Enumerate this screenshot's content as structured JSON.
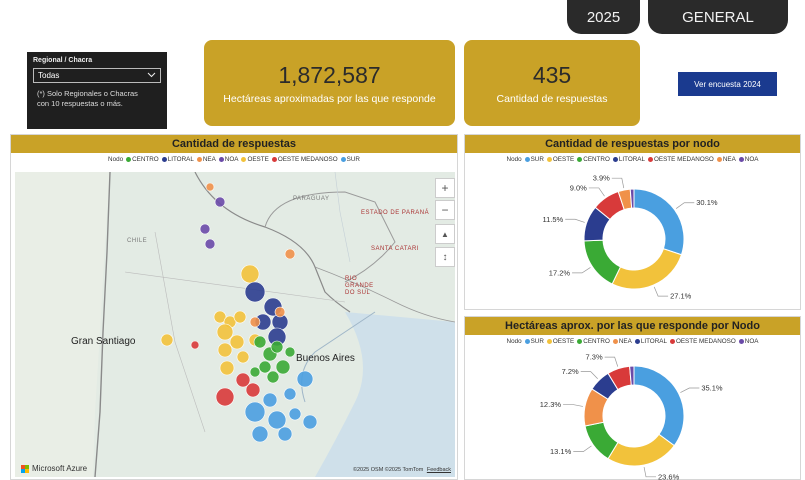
{
  "header": {
    "year_label": "2025",
    "general_label": "GENERAL"
  },
  "slicer": {
    "title": "Regional / Chacra",
    "selected": "Todas",
    "note_line1": "(*) Solo Regionales o Chacras",
    "note_line2": "con 10 respuestas o más."
  },
  "kpis": {
    "hectares_value": "1,872,587",
    "hectares_label": "Hectáreas aproximadas por las que responde",
    "responses_value": "435",
    "responses_label": "Cantidad de respuestas"
  },
  "button_2024": "Ver encuesta 2024",
  "map_panel": {
    "title": "Cantidad de respuestas",
    "legend_title": "Nodo",
    "legend": [
      {
        "name": "CENTRO",
        "color": "#3aaa35"
      },
      {
        "name": "LITORAL",
        "color": "#2b3d8f"
      },
      {
        "name": "NEA",
        "color": "#f0914a"
      },
      {
        "name": "NOA",
        "color": "#6a4aa8"
      },
      {
        "name": "OESTE",
        "color": "#f2c23b"
      },
      {
        "name": "OESTE MEDANOSO",
        "color": "#d83a3a"
      },
      {
        "name": "SUR",
        "color": "#4a9fe0"
      }
    ],
    "labels": {
      "paraguay": "PARAGUAY",
      "chile": "CHILE",
      "estado_parana": "ESTADO DE PARANÁ",
      "santa_catarina": "SANTA CATARI",
      "rio_grande": "RIO GRANDE DO SUL",
      "santiago": "Gran Santiago",
      "buenos_aires": "Buenos Aires"
    },
    "controls": {
      "zoom_in": "+",
      "zoom_out": "−",
      "tilt": "▲",
      "compass": "↕"
    },
    "brand": "Microsoft Azure",
    "attribution": "©2025 OSM ©2025 TomTom",
    "feedback": "Feedback"
  },
  "donut1": {
    "title": "Cantidad de respuestas por nodo",
    "legend_title": "Nodo",
    "legend": [
      {
        "name": "SUR",
        "color": "#4a9fe0"
      },
      {
        "name": "OESTE",
        "color": "#f2c23b"
      },
      {
        "name": "CENTRO",
        "color": "#3aaa35"
      },
      {
        "name": "LITORAL",
        "color": "#2b3d8f"
      },
      {
        "name": "OESTE MEDANOSO",
        "color": "#d83a3a"
      },
      {
        "name": "NEA",
        "color": "#f0914a"
      },
      {
        "name": "NOA",
        "color": "#6a4aa8"
      }
    ]
  },
  "donut2": {
    "title": "Hectáreas aprox. por las que responde por Nodo",
    "legend_title": "Nodo",
    "legend": [
      {
        "name": "SUR",
        "color": "#4a9fe0"
      },
      {
        "name": "OESTE",
        "color": "#f2c23b"
      },
      {
        "name": "CENTRO",
        "color": "#3aaa35"
      },
      {
        "name": "NEA",
        "color": "#f0914a"
      },
      {
        "name": "LITORAL",
        "color": "#2b3d8f"
      },
      {
        "name": "OESTE MEDANOSO",
        "color": "#d83a3a"
      },
      {
        "name": "NOA",
        "color": "#6a4aa8"
      }
    ]
  },
  "chart_data": [
    {
      "type": "pie",
      "title": "Cantidad de respuestas por nodo",
      "categories": [
        "SUR",
        "OESTE",
        "CENTRO",
        "LITORAL",
        "OESTE MEDANOSO",
        "NEA",
        "NOA"
      ],
      "values": [
        30.1,
        27.1,
        17.2,
        11.5,
        9.0,
        3.9,
        1.2
      ],
      "labels": [
        "30.1%",
        "27.1%",
        "17.2%",
        "11.5%",
        "9.0%",
        "3.9%",
        ""
      ],
      "colors": [
        "#4a9fe0",
        "#f2c23b",
        "#3aaa35",
        "#2b3d8f",
        "#d83a3a",
        "#f0914a",
        "#6a4aa8"
      ]
    },
    {
      "type": "pie",
      "title": "Hectáreas aprox. por las que responde por Nodo",
      "categories": [
        "SUR",
        "OESTE",
        "CENTRO",
        "NEA",
        "LITORAL",
        "OESTE MEDANOSO",
        "NOA"
      ],
      "values": [
        35.1,
        23.6,
        13.1,
        12.3,
        7.2,
        7.3,
        1.4
      ],
      "labels": [
        "35.1%",
        "23.6%",
        "13.1%",
        "12.3%",
        "7.2%",
        "7.3%",
        ""
      ],
      "colors": [
        "#4a9fe0",
        "#f2c23b",
        "#3aaa35",
        "#f0914a",
        "#2b3d8f",
        "#d83a3a",
        "#6a4aa8"
      ]
    }
  ]
}
